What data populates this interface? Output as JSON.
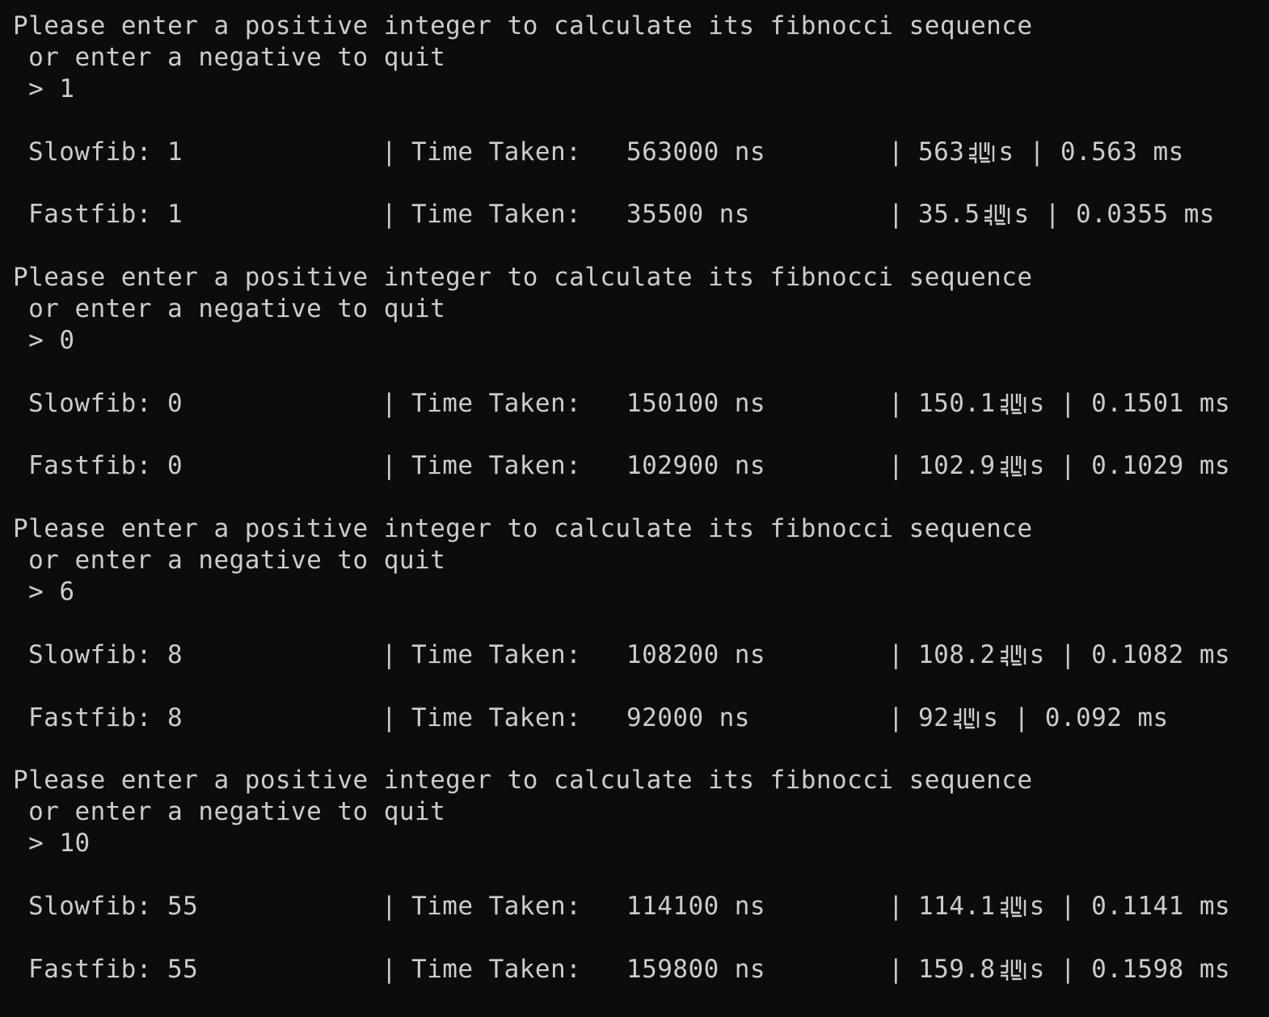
{
  "prompt": {
    "line1": "Please enter a positive integer to calculate its fibnocci sequence",
    "line2": " or enter a negative to quit"
  },
  "sessions": [
    {
      "input": " > 1",
      "rows": [
        {
          "label": "Slowfib: 1",
          "sep": "|",
          "time_label": "Time Taken:",
          "ns": "563000 ns",
          "sep2": "|",
          "us_value": "563",
          "us_unit": "s",
          "sep3": "|",
          "ms": "0.563 ms"
        },
        {
          "label": "Fastfib: 1",
          "sep": "|",
          "time_label": "Time Taken:",
          "ns": "35500 ns",
          "sep2": "|",
          "us_value": "35.5",
          "us_unit": "s",
          "sep3": "|",
          "ms": "0.0355 ms"
        }
      ]
    },
    {
      "input": " > 0",
      "rows": [
        {
          "label": "Slowfib: 0",
          "sep": "|",
          "time_label": "Time Taken:",
          "ns": "150100 ns",
          "sep2": "|",
          "us_value": "150.1",
          "us_unit": "s",
          "sep3": "|",
          "ms": "0.1501 ms"
        },
        {
          "label": "Fastfib: 0",
          "sep": "|",
          "time_label": "Time Taken:",
          "ns": "102900 ns",
          "sep2": "|",
          "us_value": "102.9",
          "us_unit": "s",
          "sep3": "|",
          "ms": "0.1029 ms"
        }
      ]
    },
    {
      "input": " > 6",
      "rows": [
        {
          "label": "Slowfib: 8",
          "sep": "|",
          "time_label": "Time Taken:",
          "ns": "108200 ns",
          "sep2": "|",
          "us_value": "108.2",
          "us_unit": "s",
          "sep3": "|",
          "ms": "0.1082 ms"
        },
        {
          "label": "Fastfib: 8",
          "sep": "|",
          "time_label": "Time Taken:",
          "ns": "92000 ns",
          "sep2": "|",
          "us_value": "92",
          "us_unit": "s",
          "sep3": "|",
          "ms": "0.092 ms"
        }
      ]
    },
    {
      "input": " > 10",
      "rows": [
        {
          "label": "Slowfib: 55",
          "sep": "|",
          "time_label": "Time Taken:",
          "ns": "114100 ns",
          "sep2": "|",
          "us_value": "114.1",
          "us_unit": "s",
          "sep3": "|",
          "ms": "0.1141 ms"
        },
        {
          "label": "Fastfib: 55",
          "sep": "|",
          "time_label": "Time Taken:",
          "ns": "159800 ns",
          "sep2": "|",
          "us_value": "159.8",
          "us_unit": "s",
          "sep3": "|",
          "ms": "0.1598 ms"
        }
      ]
    }
  ],
  "colors": {
    "background": "#0c0c0c",
    "text": "#cccccc"
  },
  "icons": {
    "micro_glyph": "unrenderable-glyph-icon"
  }
}
